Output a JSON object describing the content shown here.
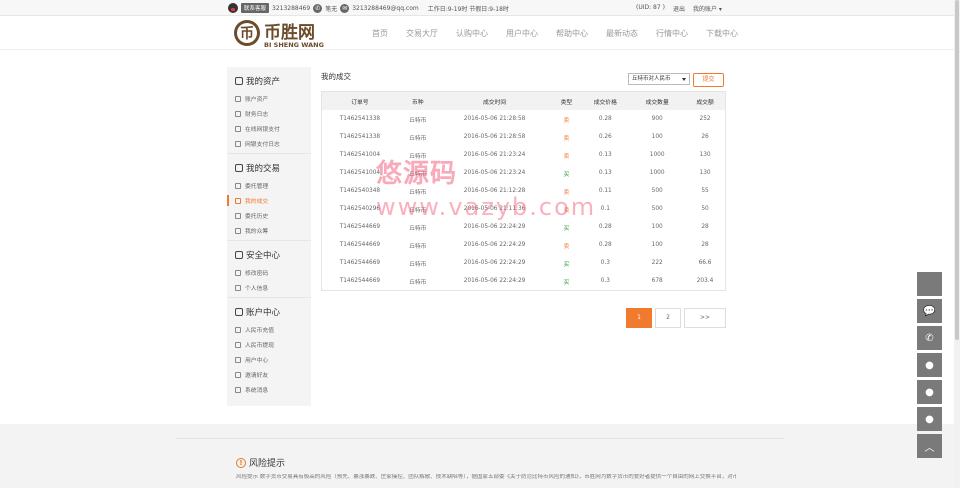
{
  "topbar": {
    "kefu_label": "联系客服",
    "qq": "3213288469",
    "wechat_label": "笔无",
    "email": "3213288469@qq.com",
    "hours": "工作日:9-19时 节假日:9-18时",
    "uid": "(UID: 87 )",
    "logout": "退出",
    "my_account": "我的账户"
  },
  "logo": {
    "text_main": "币胜网",
    "text_sub": "BI SHENG WANG"
  },
  "nav": [
    "首页",
    "交易大厅",
    "认购中心",
    "用户中心",
    "帮助中心",
    "最新动态",
    "行情中心",
    "下载中心"
  ],
  "sidebar": {
    "groups": [
      {
        "title": "我的资产",
        "items": [
          "账户资产",
          "财务日志",
          "在线网银支付",
          "网银支付日志"
        ]
      },
      {
        "title": "我的交易",
        "items": [
          "委托管理",
          "我的成交",
          "委托历史",
          "我的众筹"
        ]
      },
      {
        "title": "安全中心",
        "items": [
          "修改密码",
          "个人信息"
        ]
      },
      {
        "title": "账户中心",
        "items": [
          "人民币充值",
          "人民币提现",
          "用户中心",
          "邀请好友",
          "系统消息"
        ]
      }
    ],
    "active_item": "我的成交"
  },
  "content": {
    "title": "我的成交",
    "select_value": "丘特币对人民币",
    "submit_label": "提交"
  },
  "table": {
    "headers": [
      "订单号",
      "币种",
      "成交时间",
      "类型",
      "成交价格",
      "成交数量",
      "成交额"
    ],
    "rows": [
      [
        "T1462541338",
        "丘特币",
        "2016-05-06 21:28:58",
        "卖",
        "0.28",
        "900",
        "252"
      ],
      [
        "T1462541338",
        "丘特币",
        "2016-05-06 21:28:58",
        "卖",
        "0.26",
        "100",
        "26"
      ],
      [
        "T1462541004",
        "丘特币",
        "2016-05-06 21:23:24",
        "卖",
        "0.13",
        "1000",
        "130"
      ],
      [
        "T1462541004",
        "丘特币",
        "2016-05-06 21:23:24",
        "买",
        "0.13",
        "1000",
        "130"
      ],
      [
        "T1462540348",
        "丘特币",
        "2016-05-06 21:12:28",
        "卖",
        "0.11",
        "500",
        "55"
      ],
      [
        "T1462540296",
        "丘特币",
        "2016-05-06 21:11:36",
        "卖",
        "0.1",
        "500",
        "50"
      ],
      [
        "T1462544669",
        "丘特币",
        "2016-05-06 22:24:29",
        "买",
        "0.28",
        "100",
        "28"
      ],
      [
        "T1462544669",
        "丘特币",
        "2016-05-06 22:24:29",
        "卖",
        "0.28",
        "100",
        "28"
      ],
      [
        "T1462544669",
        "丘特币",
        "2016-05-06 22:24:29",
        "买",
        "0.3",
        "222",
        "66.6"
      ],
      [
        "T1462544669",
        "丘特币",
        "2016-05-06 22:24:29",
        "买",
        "0.3",
        "678",
        "203.4"
      ]
    ]
  },
  "pager": [
    "1",
    "2",
    ">>"
  ],
  "watermark": {
    "line1": "悠源码",
    "line2": "www.vazyb.com"
  },
  "footer": {
    "risk_title": "风险提示",
    "risk_text": "风险提示 数字货币交易具有极高的风险（预先、暴涨暴跌、庄家操控、团队解散、技术缺陷等），据国家五部委《关于防范比特币风险的通知》，币胜网为数字货币的爱好者提供一个自由的网上交换平台，对币的投资价值不承担任何审查、担保、赔偿的责任，如果您不能承担损失，请不要参与交易。谢谢！"
  },
  "colors": {
    "accent": "#f07a2e",
    "buy": "#2a9b2a",
    "sell": "#f07a2e"
  }
}
